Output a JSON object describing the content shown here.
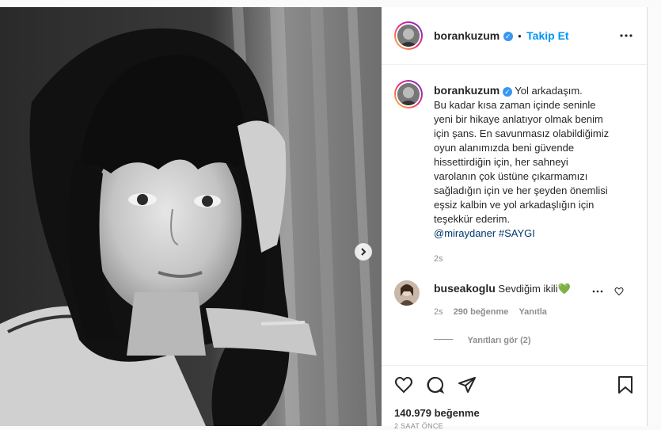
{
  "post": {
    "author": "borankuzum",
    "follow_label": "Takip Et",
    "dot": "•",
    "more_icon": "more-dots-icon",
    "caption_lines": [
      "Yol arkadaşım.",
      "Bu kadar kısa zaman içinde seninle",
      "yeni bir hikaye anlatıyor olmak benim",
      "için şans. En savunmasız olabildiğimiz",
      "oyun alanımızda beni güvende",
      "hissettirdiğin için, her sahneyi",
      "varolanın çok üstüne çıkarmamızı",
      "sağladığın için ve her şeyden önemlisi",
      "eşsiz kalbin ve yol arkadaşlığın için",
      "teşekkür ederim."
    ],
    "mention": "@miraydaner",
    "hashtag": "#SAYGI",
    "caption_time": "2s",
    "likes": "140.979 beğenme",
    "posted": "2 SAAT ÖNCE"
  },
  "comment": {
    "author": "buseakoglu",
    "text": "Sevdiğim ikili",
    "emoji": "💚",
    "time": "2s",
    "likes": "290 beğenme",
    "reply_label": "Yanıtla",
    "view_replies": "Yanıtları gör (2)"
  },
  "colors": {
    "accent": "#0095f6",
    "verified": "#3897f0",
    "heart_green": "#2ecc40"
  }
}
